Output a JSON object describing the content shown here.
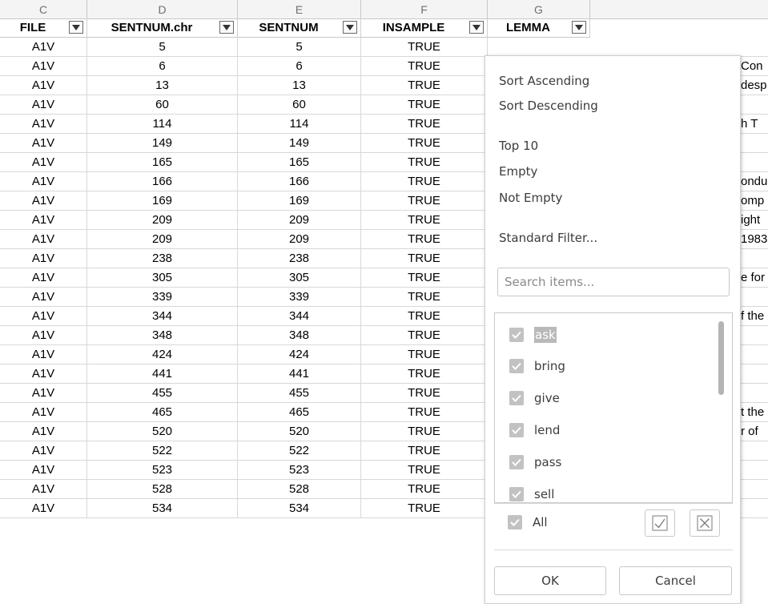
{
  "column_letters": [
    "C",
    "D",
    "E",
    "F",
    "G"
  ],
  "headers": [
    "FILE",
    "SENTNUM.chr",
    "SENTNUM",
    "INSAMPLE",
    "LEMMA"
  ],
  "rows": [
    [
      "A1V",
      "5",
      "5",
      "TRUE"
    ],
    [
      "A1V",
      "6",
      "6",
      "TRUE"
    ],
    [
      "A1V",
      "13",
      "13",
      "TRUE"
    ],
    [
      "A1V",
      "60",
      "60",
      "TRUE"
    ],
    [
      "A1V",
      "114",
      "114",
      "TRUE"
    ],
    [
      "A1V",
      "149",
      "149",
      "TRUE"
    ],
    [
      "A1V",
      "165",
      "165",
      "TRUE"
    ],
    [
      "A1V",
      "166",
      "166",
      "TRUE"
    ],
    [
      "A1V",
      "169",
      "169",
      "TRUE"
    ],
    [
      "A1V",
      "209",
      "209",
      "TRUE"
    ],
    [
      "A1V",
      "209",
      "209",
      "TRUE"
    ],
    [
      "A1V",
      "238",
      "238",
      "TRUE"
    ],
    [
      "A1V",
      "305",
      "305",
      "TRUE"
    ],
    [
      "A1V",
      "339",
      "339",
      "TRUE"
    ],
    [
      "A1V",
      "344",
      "344",
      "TRUE"
    ],
    [
      "A1V",
      "348",
      "348",
      "TRUE"
    ],
    [
      "A1V",
      "424",
      "424",
      "TRUE"
    ],
    [
      "A1V",
      "441",
      "441",
      "TRUE"
    ],
    [
      "A1V",
      "455",
      "455",
      "TRUE"
    ],
    [
      "A1V",
      "465",
      "465",
      "TRUE"
    ],
    [
      "A1V",
      "520",
      "520",
      "TRUE"
    ],
    [
      "A1V",
      "522",
      "522",
      "TRUE"
    ],
    [
      "A1V",
      "523",
      "523",
      "TRUE"
    ],
    [
      "A1V",
      "528",
      "528",
      "TRUE"
    ],
    [
      "A1V",
      "534",
      "534",
      "TRUE"
    ]
  ],
  "partial_g_text": [
    {
      "row": 1,
      "text": "Con"
    },
    {
      "row": 2,
      "text": "desp"
    },
    {
      "row": 4,
      "text": "h T"
    },
    {
      "row": 7,
      "text": "ondu"
    },
    {
      "row": 8,
      "text": "omp"
    },
    {
      "row": 9,
      "text": "ight"
    },
    {
      "row": 10,
      "text": "1983"
    },
    {
      "row": 12,
      "text": "e for"
    },
    {
      "row": 14,
      "text": "f the"
    },
    {
      "row": 19,
      "text": "t the"
    },
    {
      "row": 20,
      "text": "r of"
    }
  ],
  "filter_popup": {
    "sort_ascending": "Sort Ascending",
    "sort_descending": "Sort Descending",
    "top10": "Top 10",
    "empty": "Empty",
    "not_empty": "Not Empty",
    "standard_filter": "Standard Filter...",
    "search_placeholder": "Search items...",
    "items": [
      "ask",
      "bring",
      "give",
      "lend",
      "pass",
      "sell"
    ],
    "all_label": "All",
    "ok_label": "OK",
    "cancel_label": "Cancel",
    "icons": [
      "checkbox-check-icon",
      "filter-dropdown-icon",
      "show-only-current-icon",
      "hide-only-current-icon"
    ]
  }
}
